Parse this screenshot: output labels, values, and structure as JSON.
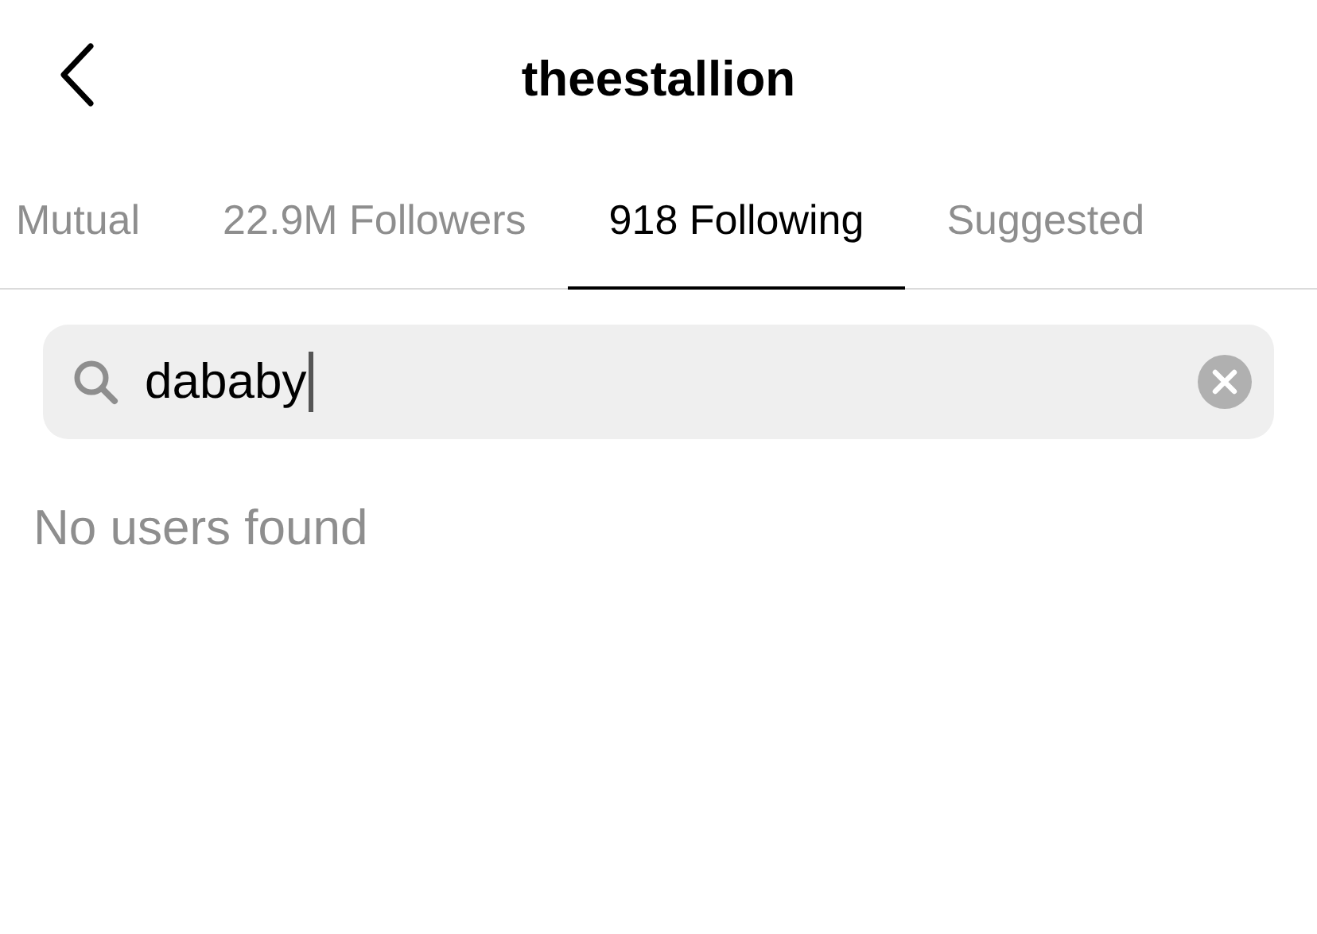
{
  "header": {
    "title": "theestallion"
  },
  "tabs": [
    {
      "label": "Mutual",
      "selected": false
    },
    {
      "label": "22.9M Followers",
      "selected": false
    },
    {
      "label": "918 Following",
      "selected": true
    },
    {
      "label": "Suggested",
      "selected": false
    }
  ],
  "search": {
    "value": "dababy"
  },
  "empty_message": "No users found"
}
